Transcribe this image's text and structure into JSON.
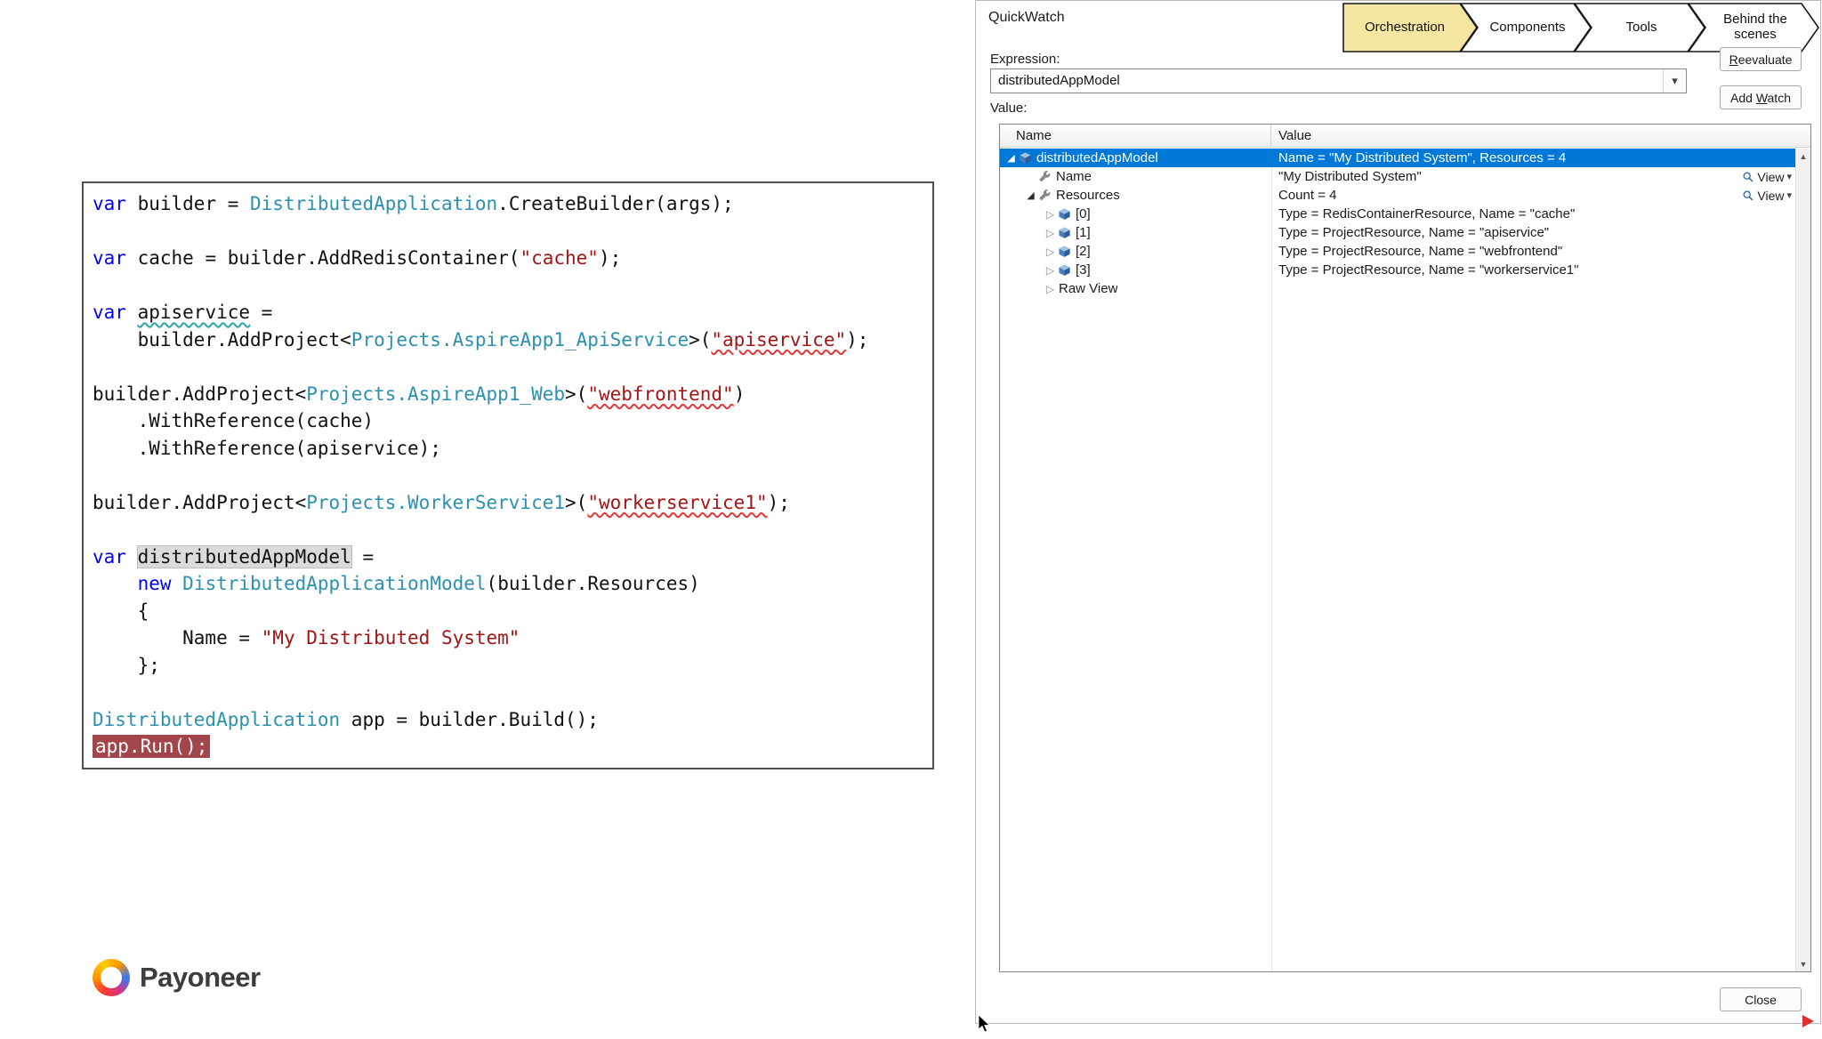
{
  "colors": {
    "keyword": "#0000FF",
    "type": "#2B91AF",
    "string": "#A31515",
    "squiggle_red": "#E03A3A",
    "squiggle_teal": "#2AA7A7",
    "exec_line_bg": "#A3464C",
    "accent_selection": "#0078D7",
    "chevron_active_fill": "#F5E6A2",
    "chevron_fill": "#FFFFFF"
  },
  "left_panel": {
    "logo_text": "Payoneer",
    "code_lines": [
      {
        "tokens": [
          [
            "k",
            "var"
          ],
          [
            "p",
            " builder = "
          ],
          [
            "t",
            "DistributedApplication"
          ],
          [
            "p",
            ".CreateBuilder(args);"
          ]
        ]
      },
      {
        "tokens": []
      },
      {
        "tokens": [
          [
            "k",
            "var"
          ],
          [
            "p",
            " cache = builder.AddRedisContainer("
          ],
          [
            "s",
            "\"cache\""
          ],
          [
            "p",
            ");"
          ]
        ]
      },
      {
        "tokens": []
      },
      {
        "tokens": [
          [
            "k",
            "var"
          ],
          [
            "p",
            " "
          ],
          [
            "idw",
            "apiservice"
          ],
          [
            "p",
            " ="
          ]
        ]
      },
      {
        "tokens": [
          [
            "p",
            "    builder.AddProject<"
          ],
          [
            "t",
            "Projects.AspireApp1_ApiService"
          ],
          [
            "p",
            ">("
          ],
          [
            "sw",
            "\"apiservice\""
          ],
          [
            "p",
            ");"
          ]
        ]
      },
      {
        "tokens": []
      },
      {
        "tokens": [
          [
            "p",
            "builder.AddProject<"
          ],
          [
            "t",
            "Projects.AspireApp1_Web"
          ],
          [
            "p",
            ">("
          ],
          [
            "sw",
            "\"webfrontend\""
          ],
          [
            "p",
            ")"
          ]
        ]
      },
      {
        "tokens": [
          [
            "p",
            "    .WithReference(cache)"
          ]
        ]
      },
      {
        "tokens": [
          [
            "p",
            "    .WithReference(apiservice);"
          ]
        ]
      },
      {
        "tokens": []
      },
      {
        "tokens": [
          [
            "p",
            "builder.AddProject<"
          ],
          [
            "t",
            "Projects.WorkerService1"
          ],
          [
            "p",
            ">("
          ],
          [
            "sw",
            "\"workerservice1\""
          ],
          [
            "p",
            ");"
          ]
        ]
      },
      {
        "tokens": []
      },
      {
        "tokens": [
          [
            "k",
            "var"
          ],
          [
            "p",
            " "
          ],
          [
            "hl",
            "distributedAppModel"
          ],
          [
            "p",
            " ="
          ]
        ]
      },
      {
        "tokens": [
          [
            "p",
            "    "
          ],
          [
            "k",
            "new"
          ],
          [
            "p",
            " "
          ],
          [
            "t",
            "DistributedApplicationModel"
          ],
          [
            "p",
            "(builder.Resources)"
          ]
        ]
      },
      {
        "tokens": [
          [
            "p",
            "    {"
          ]
        ]
      },
      {
        "tokens": [
          [
            "p",
            "        Name = "
          ],
          [
            "s",
            "\"My Distributed System\""
          ]
        ]
      },
      {
        "tokens": [
          [
            "p",
            "    };"
          ]
        ]
      },
      {
        "tokens": []
      },
      {
        "tokens": [
          [
            "t",
            "DistributedApplication"
          ],
          [
            "p",
            " app = builder.Build();"
          ]
        ]
      },
      {
        "exec": true,
        "tokens": [
          [
            "x",
            "app.Run();"
          ]
        ]
      }
    ]
  },
  "quickwatch": {
    "title": "QuickWatch",
    "chevrons": [
      {
        "label": "Orchestration",
        "active": true
      },
      {
        "label": "Components",
        "active": false
      },
      {
        "label": "Tools",
        "active": false
      },
      {
        "label": "Behind the scenes",
        "active": false
      }
    ],
    "expression_label": "Expression:",
    "expression_value": "distributedAppModel",
    "buttons": {
      "reevaluate": {
        "pre": "",
        "key": "R",
        "post": "eevaluate"
      },
      "add_watch": {
        "pre": "Add ",
        "key": "W",
        "post": "atch"
      },
      "close": {
        "pre": "",
        "key": "",
        "post": "Close"
      }
    },
    "value_label": "Value:",
    "grid": {
      "columns": [
        "Name",
        "Value"
      ],
      "view_label": "View",
      "rows": [
        {
          "name": "distributedAppModel",
          "value": "Name = \"My Distributed System\", Resources = 4",
          "level": 0,
          "expander": "expanded",
          "icon": "object",
          "selected": true,
          "view": false
        },
        {
          "name": "Name",
          "value": "\"My Distributed System\"",
          "level": 1,
          "expander": "none",
          "icon": "wrench",
          "selected": false,
          "view": true
        },
        {
          "name": "Resources",
          "value": "Count = 4",
          "level": 1,
          "expander": "expanded",
          "icon": "wrench",
          "selected": false,
          "view": true
        },
        {
          "name": "[0]",
          "value": "Type = RedisContainerResource, Name = \"cache\"",
          "level": 2,
          "expander": "collapsed",
          "icon": "object",
          "selected": false,
          "view": false
        },
        {
          "name": "[1]",
          "value": "Type = ProjectResource, Name = \"apiservice\"",
          "level": 2,
          "expander": "collapsed",
          "icon": "object",
          "selected": false,
          "view": false
        },
        {
          "name": "[2]",
          "value": "Type = ProjectResource, Name = \"webfrontend\"",
          "level": 2,
          "expander": "collapsed",
          "icon": "object",
          "selected": false,
          "view": false
        },
        {
          "name": "[3]",
          "value": "Type = ProjectResource, Name = \"workerservice1\"",
          "level": 2,
          "expander": "collapsed",
          "icon": "object",
          "selected": false,
          "view": false
        },
        {
          "name": "Raw View",
          "value": "",
          "level": 2,
          "expander": "collapsed",
          "icon": "none",
          "selected": false,
          "view": false
        }
      ]
    }
  }
}
